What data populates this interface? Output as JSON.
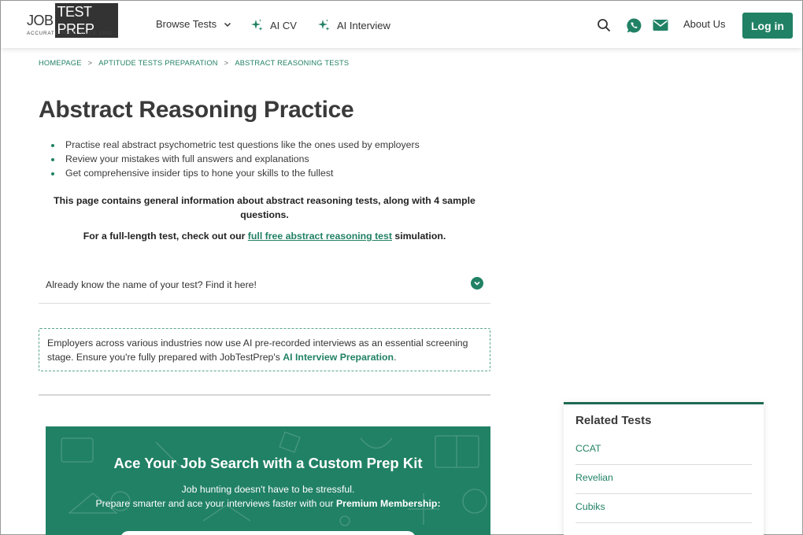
{
  "brand": {
    "logo_job": "JOB",
    "logo_testprep": "TEST PREP",
    "logo_tagline": "ACCURATE PREP SINCE 1992"
  },
  "nav": {
    "browse": "Browse Tests",
    "ai_cv": "AI CV",
    "ai_interview": "AI Interview",
    "about": "About Us",
    "login": "Log in"
  },
  "breadcrumb": [
    "HOMEPAGE",
    "APTITUDE TESTS PREPARATION",
    "ABSTRACT REASONING TESTS"
  ],
  "breadcrumb_sep": ">",
  "main": {
    "title": "Abstract Reasoning Practice",
    "bullets": [
      "Practise real abstract psychometric test questions like the ones used by employers",
      "Review your mistakes with full answers and explanations",
      "Get comprehensive insider tips to hone your skills to the fullest"
    ],
    "info1": "This page contains general information about abstract reasoning tests, along with 4 sample questions.",
    "info2_pre": "For a full-length test, check out our ",
    "info2_link": "full free abstract reasoning test",
    "info2_post": " simulation.",
    "finder": "Already know the name of your test? Find it here!",
    "ai_box_text": "Employers across various industries now use AI pre-recorded interviews as an essential screening stage. Ensure you're fully prepared with JobTestPrep's ",
    "ai_box_link": "AI Interview Preparation",
    "ai_box_end": "."
  },
  "promo": {
    "title": "Ace Your Job Search with a Custom Prep Kit",
    "sub1": "Job hunting doesn't have to be stressful.",
    "sub2_pre": "Prepare smarter and ace your interviews faster with our ",
    "sub2_bold": "Premium Membership:"
  },
  "related": {
    "title": "Related Tests",
    "items": [
      "CCAT",
      "Revelian",
      "Cubiks"
    ]
  },
  "colors": {
    "accent": "#218165",
    "text": "#333333"
  }
}
